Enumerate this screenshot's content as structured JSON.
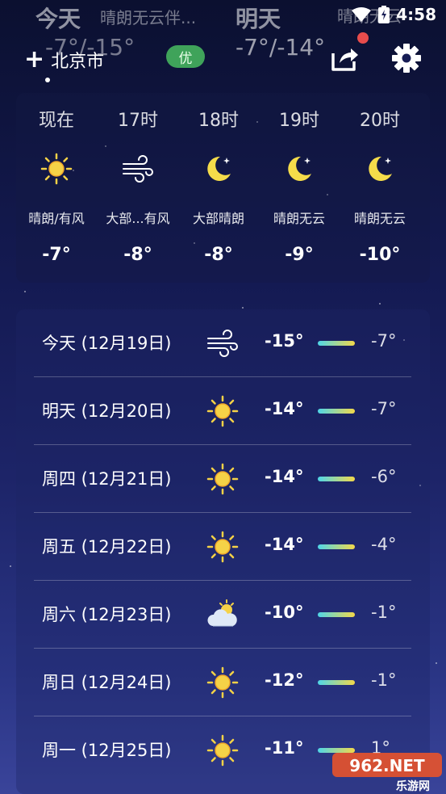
{
  "status_bar": {
    "time": "4:58"
  },
  "header": {
    "today": {
      "label": "今天",
      "condition": "晴朗无云伴...",
      "temp": "-7°/-15°"
    },
    "tomorrow": {
      "label": "明天",
      "condition": "晴朗无云",
      "temp": "-7°/-14°"
    },
    "add_label": "+",
    "city": "北京市",
    "aqi": "优"
  },
  "hourly": [
    {
      "time": "现在",
      "icon": "sun-icon",
      "cond": "晴朗/有风",
      "temp": "-7°"
    },
    {
      "time": "17时",
      "icon": "wind-icon",
      "cond": "大部...有风",
      "temp": "-8°"
    },
    {
      "time": "18时",
      "icon": "moon-icon",
      "cond": "大部晴朗",
      "temp": "-8°"
    },
    {
      "time": "19时",
      "icon": "moon-icon",
      "cond": "晴朗无云",
      "temp": "-9°"
    },
    {
      "time": "20时",
      "icon": "moon-icon",
      "cond": "晴朗无云",
      "temp": "-10°"
    }
  ],
  "daily": [
    {
      "day": "今天 (12月19日)",
      "icon": "wind-icon",
      "low": "-15°",
      "high": "-7°"
    },
    {
      "day": "明天 (12月20日)",
      "icon": "sun-icon",
      "low": "-14°",
      "high": "-7°"
    },
    {
      "day": "周四 (12月21日)",
      "icon": "sun-icon",
      "low": "-14°",
      "high": "-6°"
    },
    {
      "day": "周五 (12月22日)",
      "icon": "sun-icon",
      "low": "-14°",
      "high": "-4°"
    },
    {
      "day": "周六 (12月23日)",
      "icon": "cloudy-icon",
      "low": "-10°",
      "high": "-1°"
    },
    {
      "day": "周日 (12月24日)",
      "icon": "sun-icon",
      "low": "-12°",
      "high": "-1°"
    },
    {
      "day": "周一 (12月25日)",
      "icon": "sun-icon",
      "low": "-11°",
      "high": "1°"
    }
  ],
  "watermark": {
    "text": "962.NET",
    "sub": "乐游网"
  },
  "colors": {
    "aqi_badge": "#3fa35a",
    "sun": "#f5d247",
    "moon": "#f5dc4a",
    "notify_dot": "#e74c4c"
  }
}
